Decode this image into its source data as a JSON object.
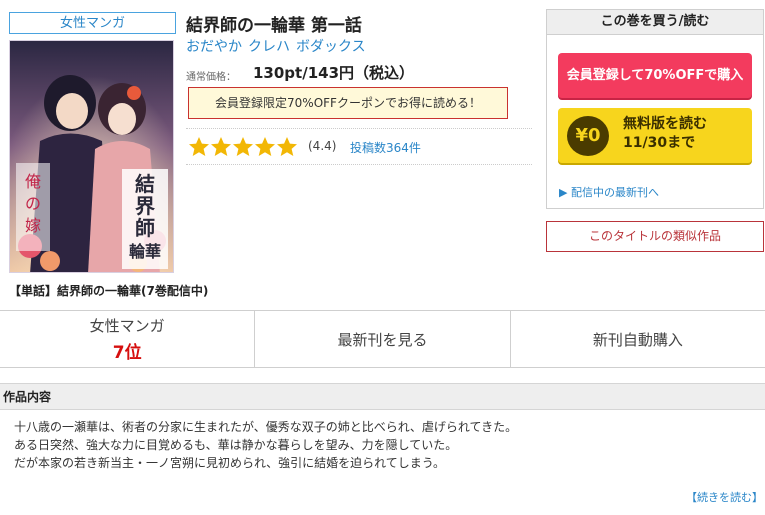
{
  "genre_tag": "女性マンガ",
  "series_label": "【単話】結界師の一輪華(7巻配信中)",
  "title": "結界師の一輪華 第一話",
  "authors": [
    "おだやか",
    "クレハ",
    "ボダックス"
  ],
  "price": {
    "caption": "通常価格：",
    "value": "130pt/143円（税込）"
  },
  "coupon": "会員登録限定70%OFFクーポンでお得に読める！",
  "rating": {
    "score": "(4.4)",
    "value": 4.4,
    "max": 5,
    "reviews": "投稿数364件"
  },
  "buy_panel": {
    "header": "この巻を買う/読む",
    "register_button": "会員登録して70%OFFで購入",
    "free_coin": "¥0",
    "free_line1": "無料版を読む",
    "free_line2": "11/30まで",
    "latest_link": "▶ 配信中の最新刊へ"
  },
  "similar_button": "このタイトルの類似作品",
  "stats": {
    "genre_label": "女性マンガ",
    "rank": "7位",
    "latest": "最新刊を見る",
    "auto_buy": "新刊自動購入"
  },
  "description": {
    "heading": "作品内容",
    "lines": [
      "十八歳の一瀬華は、術者の分家に生まれたが、優秀な双子の姉と比べられ、虐げられてきた。",
      "ある日突然、強大な力に目覚めるも、華は静かな暮らしを望み、力を隠していた。",
      "だが本家の若き新当主・一ノ宮朔に見初められ、強引に結婚を迫られてしまう。"
    ],
    "read_more": "【続きを読む】"
  },
  "colors": {
    "link": "#2a86c8",
    "register": "#f33b5e",
    "free": "#f7d51d",
    "rank": "#d60f0f",
    "similar_border": "#b9343a",
    "coupon_border": "#c9322f"
  }
}
